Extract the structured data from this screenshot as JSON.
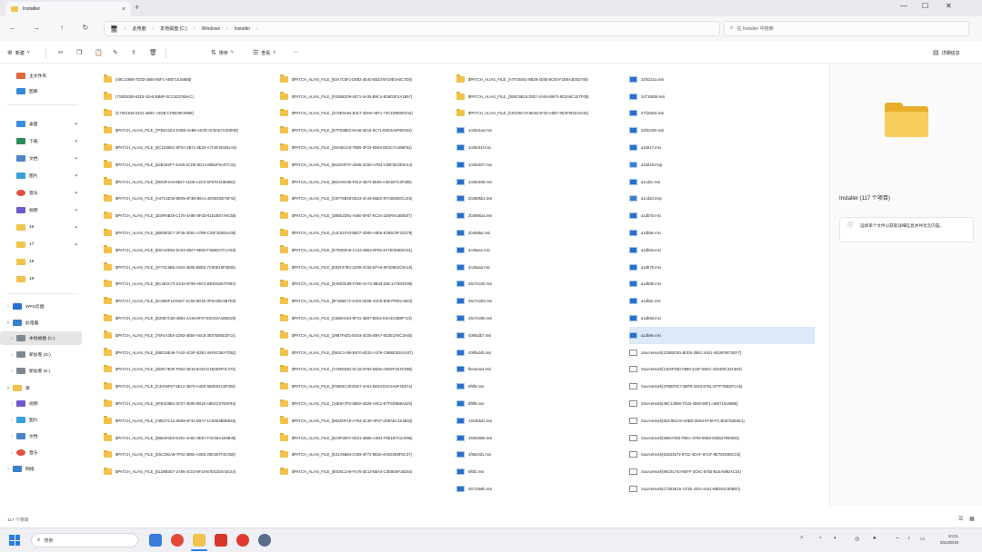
{
  "tab": {
    "title": "Installer"
  },
  "address": {
    "crumbs": [
      "此电脑",
      "本地磁盘 (C:)",
      "Windows",
      "Installer"
    ],
    "search_placeholder": "在 Installer 中搜索"
  },
  "toolbar": {
    "new_label": "新建",
    "sort_label": "排序",
    "view_label": "查看",
    "details_label": "详细信息"
  },
  "sidebar": {
    "groups": [
      [
        "主文件夹",
        "图库"
      ],
      [
        "桌面",
        "下载",
        "文档",
        "图片",
        "音乐",
        "视频",
        "16",
        "17",
        "18",
        "19"
      ],
      [
        "WPS云盘",
        "此电脑",
        "本地磁盘 (C:)",
        "新加卷 (D:)",
        "新加卷 (E:)"
      ],
      [
        "库",
        "视频",
        "图片",
        "文档",
        "音乐",
        "网络"
      ]
    ]
  },
  "files": {
    "col1": [
      "{49C12988-7D33-4560-95F1-AB0715166B8}",
      "{71B03006-8318-43A6-BB8F-0CC4D3768AC}",
      "{C7821626-9101-4B9C-AE2B-CFB849C9898}",
      "$PATCH_ALIAS_FILE_{7FB2A1E3-D45B-4AB8-AD7E-0C5AE7C00E0B}",
      "$PATCH_ALIAS_FILE_{6C1D48E2-9F0A-4B71-8E33-A7C6F2D4B1A9}",
      "$PATCH_ALIAS_FILE_{52B1E0F7-3A69-4CDE-9D14-88B2F6A07C31}",
      "$PATCH_ALIAS_FILE_{0E93F4A8-6B27-41D5-A2C0-5F87D319E6B4}",
      "$PATCH_ALIAS_FILE_{A47C2D19-8E05-4F3B-B6A1-2D90C8E75F42}",
      "$PATCH_ALIAS_FILE_{3D8F6B25-C170-4A9E-8F4D-61E2B07A9C58}",
      "$PATCH_ALIAS_FILE_{9B05E3C7-2F48-4D61-A7B9-C34F1E8D2A06}",
      "$PATCH_ALIAS_FILE_{E6A19D04-5C83-4B27-9E60-F2B8D47C1A93}",
      "$PATCH_ALIAS_FILE_{1F72C8B6-A934-4E05-B8D2-7C60E19F3B45}",
      "$PATCH_ALIAS_FILE_{8C4E0A73-D216-4F98-A5C3-B91D62E7F084}",
      "$PATCH_ALIAS_FILE_{5A3B9F12-E607-4C84-9D1E-0F6A28C5B7D3}",
      "$PATCH_ALIAS_FILE_{D20E7C59-4B81-4A36-8F07-E5C93A1B6D28}",
      "$PATCH_ALIAS_FILE_{76F4A2E8-1D93-4B50-A6C8-3E07B95D2F14}",
      "$PATCH_ALIAS_FILE_{B8D15E46-7A20-4C9F-B3E1-94F6C08A7D52}",
      "$PATCH_ALIAS_FILE_{2E9C7B30-F564-4D18-8A92-D1B3E6F0C475}",
      "$PATCH_ALIAS_FILE_{C3A08F67-9E12-4B73-A4D5-6B2E91C8F306}",
      "$PATCH_ALIAS_FILE_{4F61D9B2-3C07-4E85-9B16-A8D2C57E0F93}",
      "$PATCH_ALIAS_FILE_{A9E27C14-6D58-4F31-B0A7-1C94E3B8D625}",
      "$PATCH_ALIAS_FILE_{0B84F6D3-E291-4A6C-8D57-F3C06A1E9B48}",
      "$PATCH_ALIAS_FILE_{E5C391A8-7F04-4B92-A3D6-28E1B7F4C059}",
      "$PATCH_ALIAS_FILE_{61D8B4E7-2A95-4C03-9F18-B7E52D0A3C64}"
    ],
    "col2": [
      "$PATCH_ALIAS_FILE_{93A7C5F1-D682-4E40-8B23-5F19E0A6C7D8}",
      "$PATCH_ALIAS_FILE_{F82B6D09-4E71-4A35-B9C4-E06D3F2A1B57}",
      "$PATCH_ALIAS_FILE_{2C5E9A84-B317-4D06-A8F1-73C4D9B2E0A6}",
      "$PATCH_ALIAS_FILE_{D7F03B62-9A48-4E15-8C71-B2E6A5F9D043}",
      "$PATCH_ALIAS_FILE_{48A6E1C9-7B05-4F23-9D84-0E3C7A1B6F52}",
      "$PATCH_ALIAS_FILE_{B1D94F37-2E86-4C50-A7B3-C85F0D2E9A14}",
      "$PATCH_ALIAS_FILE_{6E3A8C05-F912-4B74-8E06-A4D1B7C3F295}",
      "$PATCH_ALIAS_FILE_{C0F75B28-6D43-4A19-B5E2-97A3E8D0C146}",
      "$PATCH_ALIAS_FILE_{3B8E2D91-A560-4F87-9C34-1D6F8A2B5E07}",
      "$PATCH_ALIAS_FILE_{A4C61F53-8B27-4D90-A6E8-E2B5C9F1D378}",
      "$PATCH_ALIAS_FILE_{57D0E8A6-C134-4B62-8F95-3A7E0D6B2C81}",
      "$PATCH_ALIAS_FILE_{E92F47B3-1D08-4C56-B7A0-6F4D9E3C8A15}",
      "$PATCH_ALIAS_FILE_{0A6D3C89-F25E-4A71-9B43-D8C1A7E5F206}",
      "$PATCH_ALIAS_FILE_{8F1B5E72-4A93-4D28-A0C6-B3E7F9D1A584}",
      "$PATCH_ALIAS_FILE_{C5E8A024-6F31-4B97-8D52-E0A4C6B8F713}",
      "$PATCH_ALIAS_FILE_{29B7F6D1-E843-4C05-B9A7-5D2E1F8C3A60}",
      "$PATCH_ALIAS_FILE_{D84C1A69-B570-4E32-A1F8-C9B6E3D0A247}",
      "$PATCH_ALIAS_FILE_{7A3E9D52-0C16-4F84-8B25-A6D8F1E4C93B}",
      "$PATCH_ALIAS_FILE_{F06B4C38-D927-4A51-9E63-B1C5A8F2D074}",
      "$PATCH_ALIAS_FILE_{14E8A7F5-3B60-4D29-A8C1-E7F3D9B6A520}",
      "$PATCH_ALIAS_FILE_{B62D0F19-A784-4C3E-8F57-2D9A6C1E4B83}",
      "$PATCH_ALIAS_FILE_{5C9F3E07-6D21-4B85-A3D4-F8E1B7C2A096}",
      "$PATCH_ALIAS_FILE_{E31A6B84-C059-4F72-9B18-4A6D2E8F5C37}",
      "$PATCH_ALIAS_FILE_{80D5C2A9-F476-4E13-B8A0-C3E9D6F1B254}"
    ],
    "col3": [
      "$PATCH_ALIAS_FILE_{A7F24E61-9B38-4D05-8C92-F1B6A3E0D748}",
      "$PATCH_ALIAS_FILE_{3E6C8B15-D027-4A94-B6F3-8D2A5C1E7F09}",
      "$PATCH_ALIAS_FILE_{C91D5A73-6E48-4F20-A5B7-0E4F9D3C6A81}",
      "1c6bc5a4.msi",
      "1c6bc61f.msi",
      "1c6bc607.msi",
      "1c6bc608.msi",
      "2b4885b1.msi",
      "2b48862a.msi",
      "2b4886a.msi",
      "4c35a4e.msi",
      "4c35aa3.msi",
      "25c7e34b.msi",
      "25c7e363.msi",
      "25c7e395.msi",
      "409fadb7.msi",
      "409fad45.msi",
      "f6e4eaa4.msi",
      "8f8f5.msi",
      "8f8f5.msi",
      "1403b5d1.msi",
      "16062696.msi",
      "1f96c0d1.msi",
      "8f6f2.msi",
      "2671058b.msi"
    ],
    "col4": [
      "32f4221a.msi",
      "24718628.msi",
      "27f15818.msi",
      "32f42320.msi",
      "a1b817.msi",
      "a1b818.msp",
      "a1cd2c.msi",
      "a1cd2d.msp",
      "a1db7b.msi",
      "a1db8e.msi",
      "a1db8a.msi",
      "a1db75.msi",
      "a1db8b.msi",
      "a1db8c.msi",
      "a1db8d.msi",
      "a1db8e.msi",
      "SourceHash{1D0B0291-B0D5-35EC-8441-6616F5674EF7}",
      "SourceHash{1403F93D-0689-415F-B62C-1D5D0C3214E6}",
      "SourceHash{37BBF9C7-B9F8-3253-8781-2F7F7B6DFCA5}",
      "SourceHash{49C12988-7D33-4560-95F1-AB0715166B8}",
      "SourceHash{5DC9D2A0-40BD-3D84-8746-FC4D2FD2B4E1}",
      "SourceHash{58927060-F8EA-3708-98E8-025B37950902}",
      "SourceHash{61B44572-8722-4DAF-8ACF-8E76D208CC5}",
      "SourceHash{86C61740-9EFF-3C9C-8755-B1EA89DAC34}",
      "SourceHash{C7282E15-CF2E-4321-8151-8BD94C90BE0}"
    ]
  },
  "preview": {
    "title": "Installer (117 个项目)",
    "info": "选择单个文件以获取详细信息并共享云内容。"
  },
  "status": {
    "count": "117 个项目"
  },
  "taskbar": {
    "search_placeholder": "搜索",
    "time": "10:21",
    "date": "2024/9/19"
  }
}
